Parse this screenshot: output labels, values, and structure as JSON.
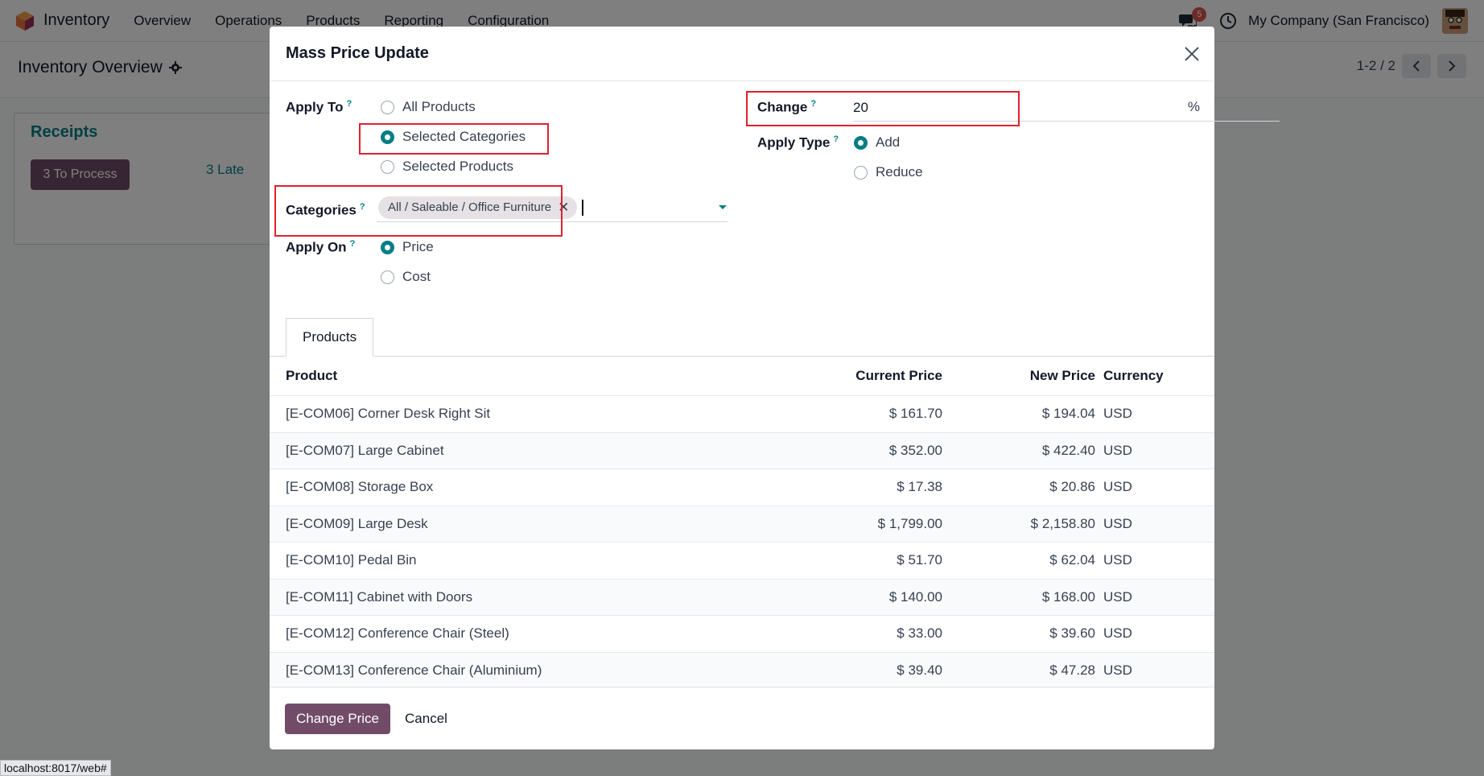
{
  "topbar": {
    "app_name": "Inventory",
    "nav": [
      "Overview",
      "Operations",
      "Products",
      "Reporting",
      "Configuration"
    ],
    "chat_badge": "5",
    "company": "My Company (San Francisco)"
  },
  "control_panel": {
    "breadcrumb": "Inventory Overview",
    "pager": "1-2 / 2"
  },
  "receipts": {
    "title": "Receipts",
    "process_button": "3 To Process",
    "late_link": "3 Late"
  },
  "modal": {
    "title": "Mass Price Update",
    "apply_to": {
      "label": "Apply To",
      "options": [
        "All Products",
        "Selected Categories",
        "Selected Products"
      ],
      "selected": "Selected Categories"
    },
    "categories": {
      "label": "Categories",
      "tags": [
        "All / Saleable / Office Furniture"
      ]
    },
    "apply_on": {
      "label": "Apply On",
      "options": [
        "Price",
        "Cost"
      ],
      "selected": "Price"
    },
    "change": {
      "label": "Change",
      "value": "20",
      "unit": "%"
    },
    "apply_type": {
      "label": "Apply Type",
      "options": [
        "Add",
        "Reduce"
      ],
      "selected": "Add"
    },
    "tabs": [
      "Products"
    ],
    "table": {
      "headers": {
        "product": "Product",
        "current_price": "Current Price",
        "new_price": "New Price",
        "currency": "Currency"
      },
      "rows": [
        {
          "product": "[E-COM06] Corner Desk Right Sit",
          "current_price": "$ 161.70",
          "new_price": "$ 194.04",
          "currency": "USD"
        },
        {
          "product": "[E-COM07] Large Cabinet",
          "current_price": "$ 352.00",
          "new_price": "$ 422.40",
          "currency": "USD"
        },
        {
          "product": "[E-COM08] Storage Box",
          "current_price": "$ 17.38",
          "new_price": "$ 20.86",
          "currency": "USD"
        },
        {
          "product": "[E-COM09] Large Desk",
          "current_price": "$ 1,799.00",
          "new_price": "$ 2,158.80",
          "currency": "USD"
        },
        {
          "product": "[E-COM10] Pedal Bin",
          "current_price": "$ 51.70",
          "new_price": "$ 62.04",
          "currency": "USD"
        },
        {
          "product": "[E-COM11] Cabinet with Doors",
          "current_price": "$ 140.00",
          "new_price": "$ 168.00",
          "currency": "USD"
        },
        {
          "product": "[E-COM12] Conference Chair (Steel)",
          "current_price": "$ 33.00",
          "new_price": "$ 39.60",
          "currency": "USD"
        },
        {
          "product": "[E-COM13] Conference Chair (Aluminium)",
          "current_price": "$ 39.40",
          "new_price": "$ 47.28",
          "currency": "USD"
        }
      ]
    },
    "buttons": {
      "primary": "Change Price",
      "secondary": "Cancel"
    }
  },
  "status_bar_url": "localhost:8017/web#",
  "colors": {
    "brand": "#714b67",
    "accent": "#017e84",
    "highlight": "#e0202e"
  }
}
